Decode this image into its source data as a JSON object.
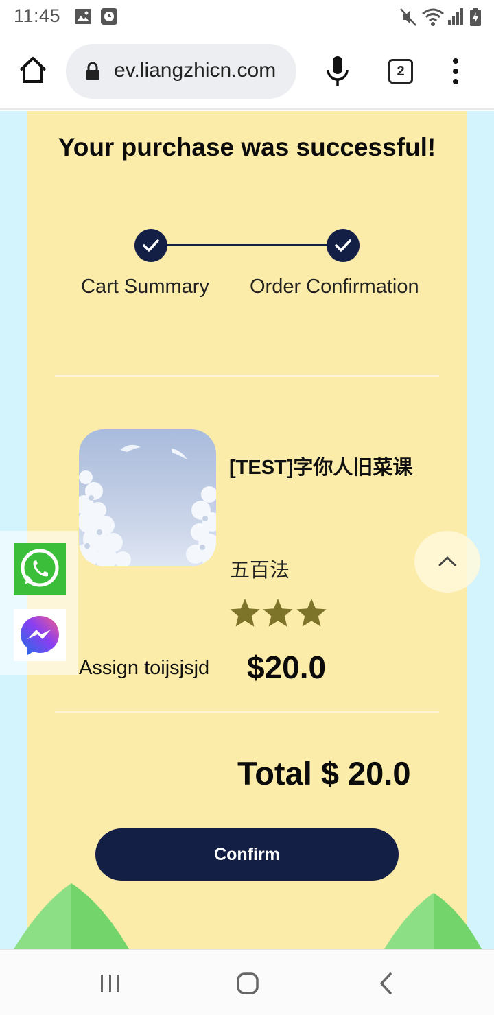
{
  "status_bar": {
    "time": "11:45",
    "left_icons": [
      "image-icon",
      "alarm-app-icon"
    ],
    "right_icons": [
      "mute-icon",
      "wifi-icon",
      "signal-icon",
      "battery-charging-icon"
    ]
  },
  "browser": {
    "url": "ev.liangzhicn.com",
    "tab_count": "2",
    "icons": [
      "home-icon",
      "lock-icon",
      "mic-icon",
      "tabs-icon",
      "more-vert-icon"
    ]
  },
  "page": {
    "title": "Your purchase was successful!",
    "steps": [
      {
        "label": "Cart Summary",
        "completed": true
      },
      {
        "label": "Order Confirmation",
        "completed": true
      }
    ],
    "product": {
      "title": "[TEST]字你人旧菜课",
      "subtitle": "五百法",
      "rating": 3,
      "assign_label": "Assign toijsjsjd",
      "price": "$20.0"
    },
    "total": "Total $ 20.0",
    "confirm_label": "Confirm"
  },
  "widgets": {
    "social": [
      "whatsapp-icon",
      "messenger-icon"
    ],
    "scroll_top": "chevron-up-icon"
  },
  "colors": {
    "card_bg": "#fcecaa",
    "page_bg": "#d3f3fd",
    "accent_navy": "#141f45",
    "star": "#7d742a",
    "leaf_green": "#7fd87a"
  }
}
